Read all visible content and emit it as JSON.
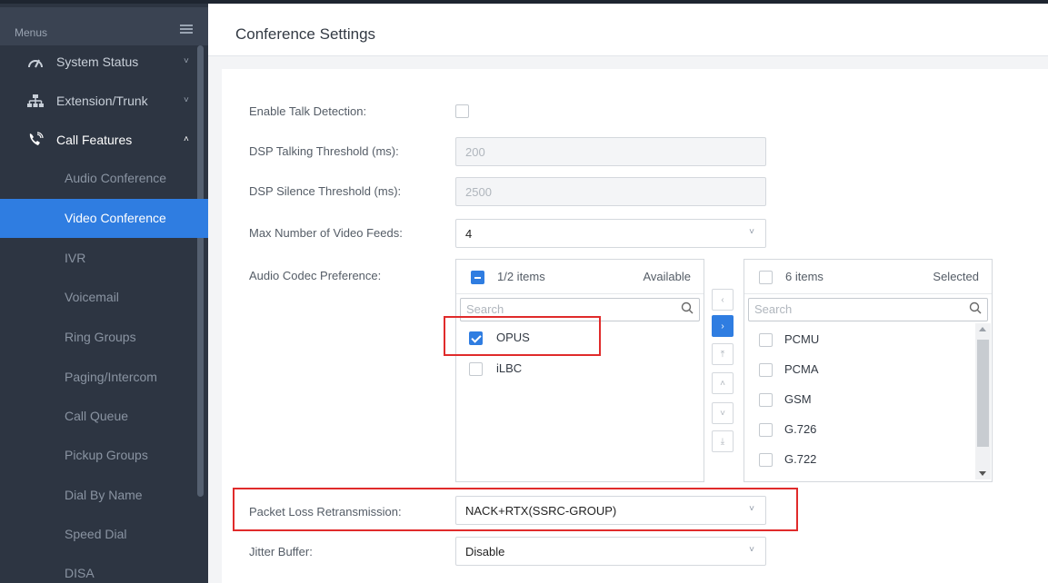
{
  "sidebar": {
    "menus_label": "Menus",
    "items": [
      {
        "label": "System Status",
        "icon": "gauge-icon",
        "chevron": "˅"
      },
      {
        "label": "Extension/Trunk",
        "icon": "network-icon",
        "chevron": "˅"
      },
      {
        "label": "Call Features",
        "icon": "phone-icon",
        "chevron": "˄"
      }
    ],
    "sub_items": [
      "Audio Conference",
      "Video Conference",
      "IVR",
      "Voicemail",
      "Ring Groups",
      "Paging/Intercom",
      "Call Queue",
      "Pickup Groups",
      "Dial By Name",
      "Speed Dial",
      "DISA"
    ],
    "active_sub_item": "Video Conference"
  },
  "header": {
    "title": "Conference Settings"
  },
  "form": {
    "enable_talk_detection": {
      "label": "Enable Talk Detection:",
      "checked": false
    },
    "dsp_talking_threshold": {
      "label": "DSP Talking Threshold (ms):",
      "value": "200"
    },
    "dsp_silence_threshold": {
      "label": "DSP Silence Threshold (ms):",
      "value": "2500"
    },
    "max_video_feeds": {
      "label": "Max Number of Video Feeds:",
      "value": "4"
    },
    "audio_codec": {
      "label": "Audio Codec Preference:",
      "available": {
        "count": "1/2 items",
        "title": "Available",
        "search_placeholder": "Search",
        "items": [
          {
            "label": "OPUS",
            "checked": true
          },
          {
            "label": "iLBC",
            "checked": false
          }
        ]
      },
      "selected": {
        "count": "6 items",
        "title": "Selected",
        "search_placeholder": "Search",
        "items": [
          {
            "label": "PCMU",
            "checked": false
          },
          {
            "label": "PCMA",
            "checked": false
          },
          {
            "label": "GSM",
            "checked": false
          },
          {
            "label": "G.726",
            "checked": false
          },
          {
            "label": "G.722",
            "checked": false
          }
        ]
      },
      "operations": {
        "left": "‹",
        "right": "›",
        "top": "⤒",
        "up": "˄",
        "down": "˅",
        "bottom": "⤓"
      }
    },
    "packet_loss": {
      "label": "Packet Loss Retransmission:",
      "value": "NACK+RTX(SSRC-GROUP)"
    },
    "jitter_buffer": {
      "label": "Jitter Buffer:",
      "value": "Disable"
    },
    "select_arrow": "˅"
  },
  "colors": {
    "accent": "#2f7de1",
    "highlight": "#e02b2b",
    "sidebar": "#2d3542"
  }
}
